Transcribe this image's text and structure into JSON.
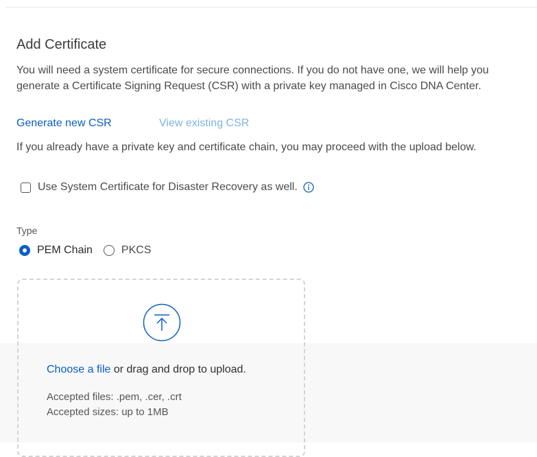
{
  "dialog": {
    "title": "Add Certificate",
    "intro": "You will need a system certificate for secure connections. If you do not have one, we will help you generate a Certificate Signing Request (CSR) with a private key managed in Cisco DNA Center.",
    "generate_csr": "Generate new CSR",
    "view_csr": "View existing CSR",
    "upload_note": "If you already have a private key and certificate chain, you may proceed with the upload below.",
    "dr_checkbox_label": "Use System Certificate for Disaster Recovery as well.",
    "dr_checked": false,
    "info_icon": "info-icon"
  },
  "type": {
    "label": "Type",
    "options": [
      {
        "label": "PEM Chain",
        "selected": true
      },
      {
        "label": "PKCS",
        "selected": false
      }
    ]
  },
  "dropzone": {
    "icon": "upload-arrow-icon",
    "choose_link": "Choose a file",
    "choose_rest": " or drag and drop to upload.",
    "accepted_files": "Accepted files: .pem, .cer, .crt",
    "accepted_sizes": "Accepted sizes: up to 1MB"
  },
  "colors": {
    "accent": "#0a5ec4",
    "muted_link": "#7fb2e6",
    "text": "#4a4a4a",
    "dashed_border": "#d3d3d3"
  }
}
